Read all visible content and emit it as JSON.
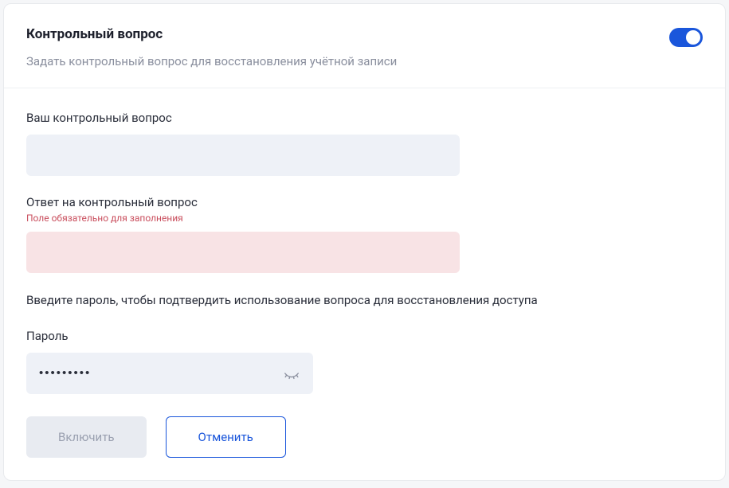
{
  "header": {
    "title": "Контрольный вопрос",
    "subtitle": "Задать контрольный вопрос для восстановления учётной записи",
    "toggle_on": true
  },
  "fields": {
    "question": {
      "label": "Ваш контрольный вопрос",
      "value": ""
    },
    "answer": {
      "label": "Ответ на контрольный вопрос",
      "error": "Поле обязательно для заполнения",
      "value": ""
    },
    "password_instruction": "Введите пароль, чтобы подтвердить использование вопроса для восстановления доступа",
    "password": {
      "label": "Пароль",
      "value": "•••••••••"
    }
  },
  "actions": {
    "enable": "Включить",
    "cancel": "Отменить"
  }
}
